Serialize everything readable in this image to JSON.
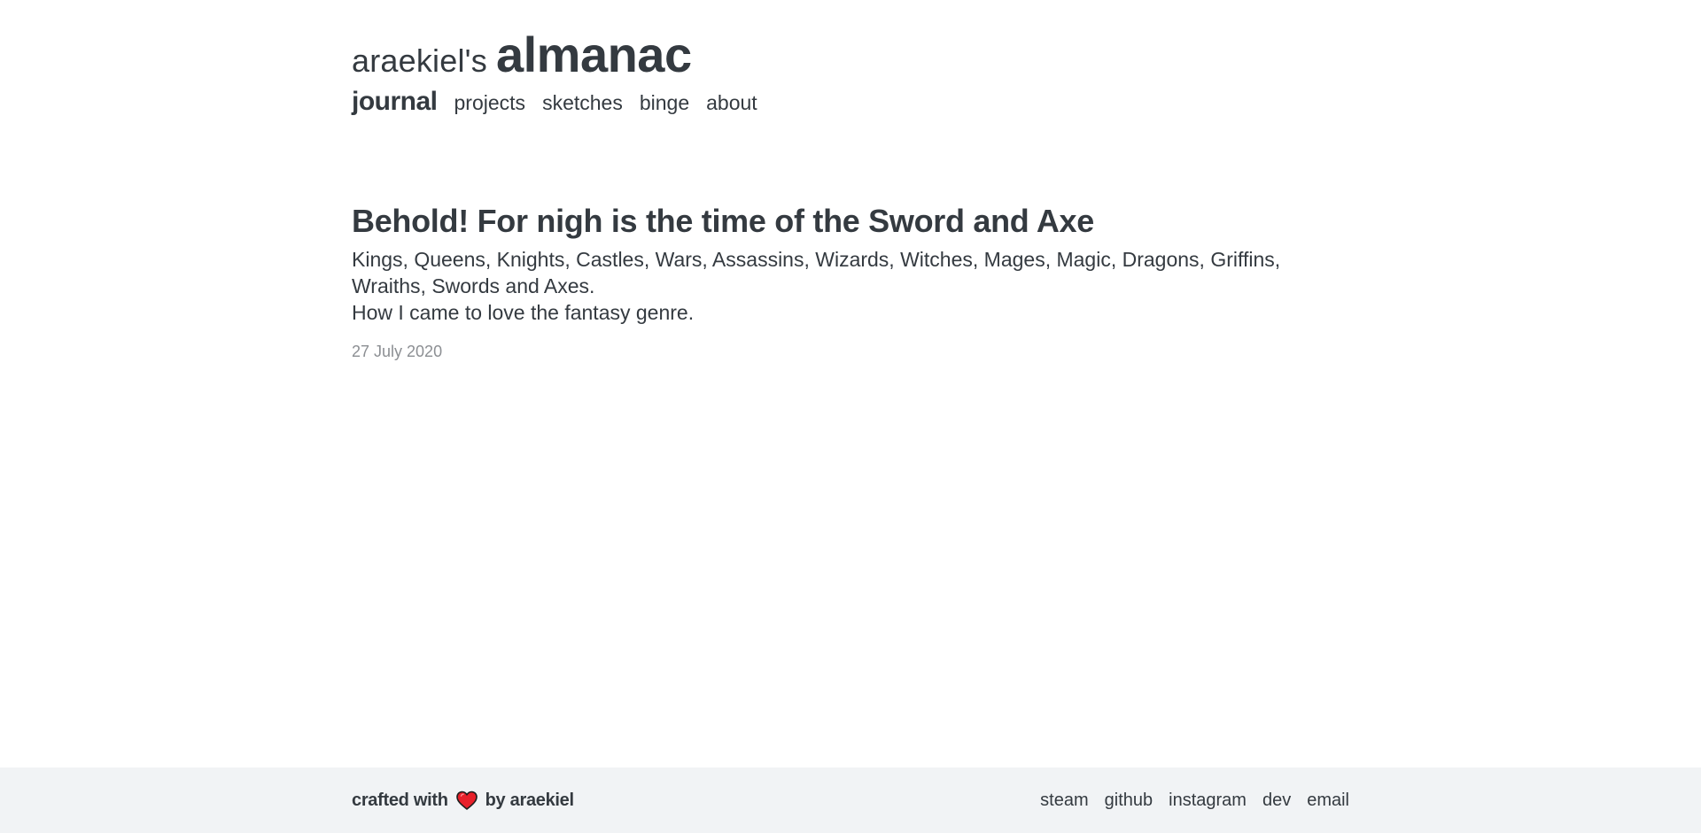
{
  "site": {
    "owner": "araekiel's",
    "name": "almanac"
  },
  "nav": {
    "items": [
      {
        "label": "journal",
        "active": true
      },
      {
        "label": "projects",
        "active": false
      },
      {
        "label": "sketches",
        "active": false
      },
      {
        "label": "binge",
        "active": false
      },
      {
        "label": "about",
        "active": false
      }
    ]
  },
  "post": {
    "title": "Behold! For nigh is the time of the Sword and Axe",
    "summary_line1": "Kings, Queens, Knights, Castles, Wars, Assassins, Wizards, Witches, Mages, Magic, Dragons, Griffins, Wraiths, Swords and Axes.",
    "summary_line2": "How I came to love the fantasy genre.",
    "date": "27 July 2020"
  },
  "footer": {
    "credit_prefix": "crafted with",
    "credit_icon": "heart-icon",
    "credit_suffix": "by araekiel",
    "links": [
      "steam",
      "github",
      "instagram",
      "dev",
      "email"
    ]
  },
  "colors": {
    "text": "#343a40",
    "muted": "#8c8f93",
    "footer_bg": "#f1f3f5",
    "heart": "#e8202a"
  }
}
